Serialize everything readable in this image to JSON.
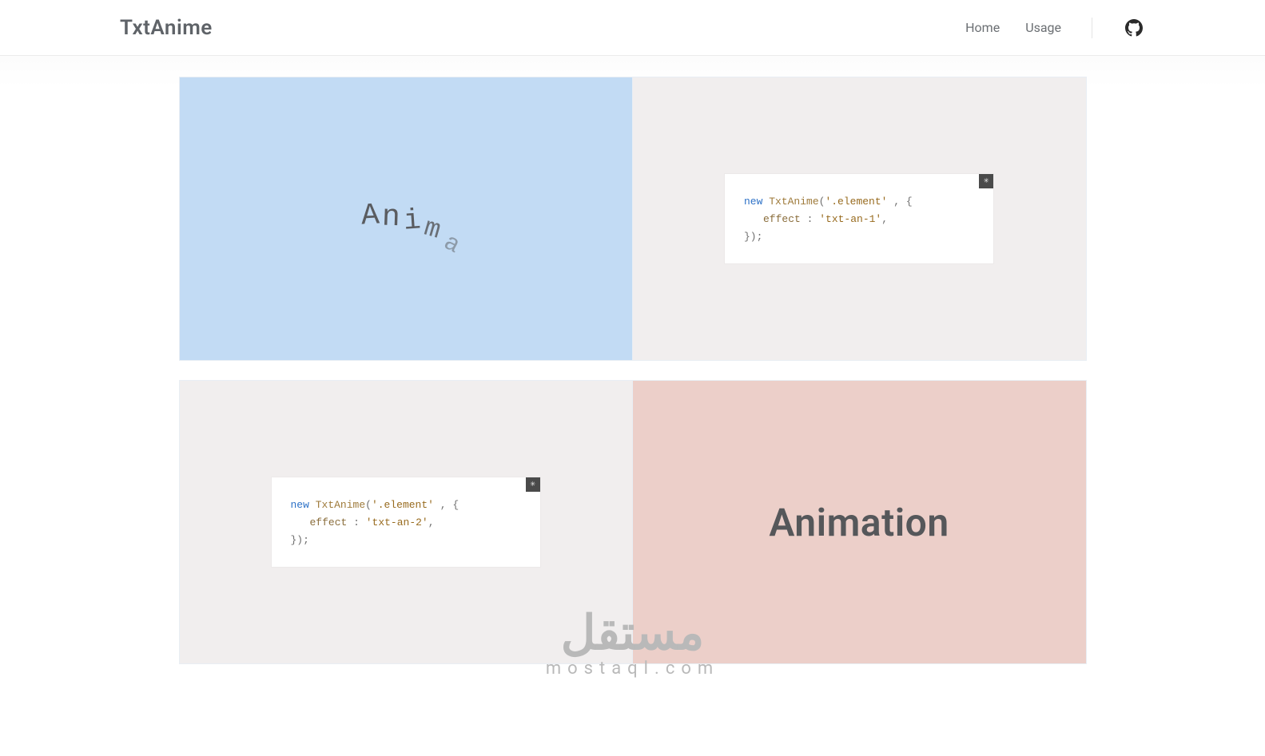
{
  "header": {
    "logo": "TxtAnime",
    "nav": {
      "home": "Home",
      "usage": "Usage"
    }
  },
  "section1": {
    "demo_letters": {
      "l1": "A",
      "l2": "n",
      "l3": "i",
      "l4": "m",
      "l5": "a"
    },
    "code": {
      "kw_new": "new",
      "clazz": "TxtAnime",
      "open": "(",
      "arg1": "'.element'",
      "comma": " , {",
      "prop_name": "effect",
      "colon": " : ",
      "prop_val": "'txt-an-1'",
      "tail_comma": ",",
      "close": "});"
    }
  },
  "section2": {
    "demo_word": "Animation",
    "code": {
      "kw_new": "new",
      "clazz": "TxtAnime",
      "open": "(",
      "arg1": "'.element'",
      "comma": " , {",
      "prop_name": "effect",
      "colon": " : ",
      "prop_val": "'txt-an-2'",
      "tail_comma": ",",
      "close": "});"
    }
  },
  "watermark": {
    "line1": "مستقل",
    "line2": "mostaql.com"
  }
}
